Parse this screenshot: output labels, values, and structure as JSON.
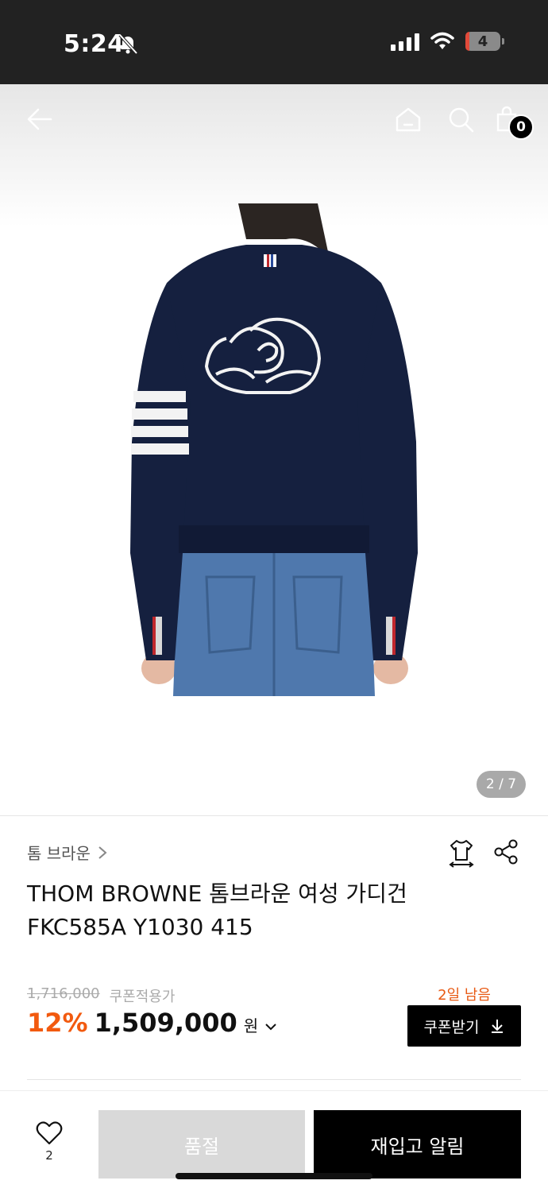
{
  "status_bar": {
    "time": "5:24",
    "battery": "4"
  },
  "header": {
    "cart_count": "0"
  },
  "gallery": {
    "counter": "2 / 7"
  },
  "product": {
    "brand": "톰 브라운",
    "title_line1": "THOM BROWNE 톰브라운 여성 가디건",
    "title_line2": "FKC585A Y1030 415",
    "original_price": "1,716,000",
    "coupon_note": "쿠폰적용가",
    "discount": "12%",
    "price": "1,509,000",
    "currency": "원",
    "days_left": "2일 남음",
    "coupon_button": "쿠폰받기"
  },
  "bottom_bar": {
    "wish_count": "2",
    "soldout_label": "품절",
    "restock_label": "재입고 알림"
  },
  "colors": {
    "accent": "#f25a0f",
    "dark": "#000000",
    "disabled": "#d9d9d9"
  }
}
